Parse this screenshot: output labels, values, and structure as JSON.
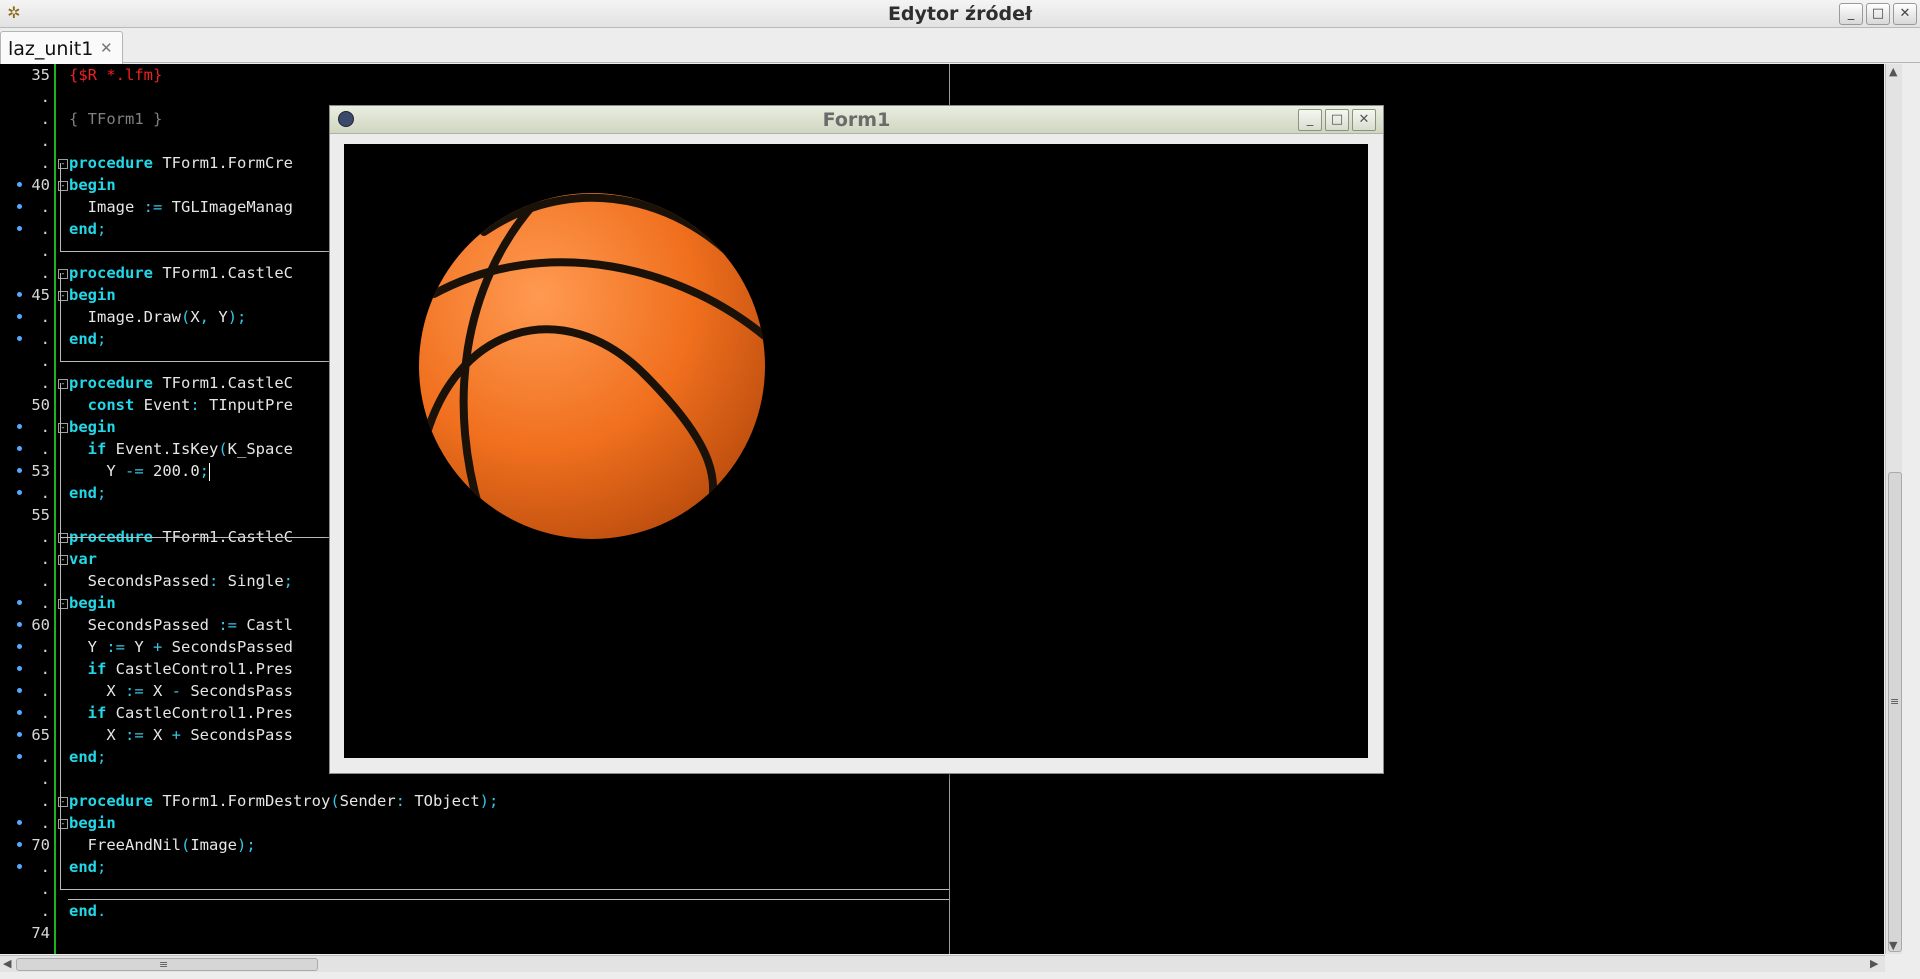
{
  "window": {
    "title": "Edytor źródeł",
    "min": "_",
    "max": "□",
    "close": "✕",
    "app_icon": "gear-star-icon"
  },
  "tab": {
    "label": "laz_unit1",
    "close": "✕"
  },
  "editor": {
    "rows": [
      {
        "ln": "35",
        "dot": false,
        "fold": false,
        "code": [
          [
            "dir",
            "{$R *.lfm}"
          ]
        ]
      },
      {
        "ln": ".",
        "dot": false,
        "fold": false,
        "code": []
      },
      {
        "ln": ".",
        "dot": false,
        "fold": false,
        "code": [
          [
            "cm",
            "{ TForm1 }"
          ]
        ]
      },
      {
        "ln": ".",
        "dot": false,
        "fold": false,
        "code": []
      },
      {
        "ln": ".",
        "dot": false,
        "fold": true,
        "code": [
          [
            "kw",
            "procedure"
          ],
          [
            "txt",
            " TForm1.FormCre"
          ]
        ]
      },
      {
        "ln": "40",
        "dot": true,
        "fold": true,
        "code": [
          [
            "kw",
            "begin"
          ]
        ]
      },
      {
        "ln": ".",
        "dot": true,
        "fold": false,
        "code": [
          [
            "txt",
            "  Image "
          ],
          [
            "sym",
            ":="
          ],
          [
            "txt",
            " TGLImageManag"
          ]
        ]
      },
      {
        "ln": ".",
        "dot": true,
        "fold": false,
        "code": [
          [
            "kw",
            "end"
          ],
          [
            "sym",
            ";"
          ]
        ]
      },
      {
        "ln": ".",
        "dot": false,
        "fold": false,
        "code": []
      },
      {
        "ln": ".",
        "dot": false,
        "fold": true,
        "code": [
          [
            "kw",
            "procedure"
          ],
          [
            "txt",
            " TForm1.CastleC"
          ]
        ]
      },
      {
        "ln": "45",
        "dot": true,
        "fold": true,
        "code": [
          [
            "kw",
            "begin"
          ]
        ]
      },
      {
        "ln": ".",
        "dot": true,
        "fold": false,
        "code": [
          [
            "txt",
            "  Image.Draw"
          ],
          [
            "sym",
            "("
          ],
          [
            "txt",
            "X"
          ],
          [
            "sym",
            ", "
          ],
          [
            "txt",
            "Y"
          ],
          [
            "sym",
            ");"
          ]
        ]
      },
      {
        "ln": ".",
        "dot": true,
        "fold": false,
        "code": [
          [
            "kw",
            "end"
          ],
          [
            "sym",
            ";"
          ]
        ]
      },
      {
        "ln": ".",
        "dot": false,
        "fold": false,
        "code": []
      },
      {
        "ln": ".",
        "dot": false,
        "fold": true,
        "code": [
          [
            "kw",
            "procedure"
          ],
          [
            "txt",
            " TForm1.CastleC"
          ]
        ]
      },
      {
        "ln": "50",
        "dot": false,
        "fold": false,
        "code": [
          [
            "kw",
            "  const"
          ],
          [
            "txt",
            " Event"
          ],
          [
            "sym",
            ":"
          ],
          [
            "txt",
            " TInputPre"
          ]
        ]
      },
      {
        "ln": ".",
        "dot": true,
        "fold": true,
        "code": [
          [
            "kw",
            "begin"
          ]
        ]
      },
      {
        "ln": ".",
        "dot": true,
        "fold": false,
        "code": [
          [
            "kw",
            "  if"
          ],
          [
            "txt",
            " Event.IsKey"
          ],
          [
            "sym",
            "("
          ],
          [
            "txt",
            "K_Space"
          ]
        ]
      },
      {
        "ln": "53",
        "dot": true,
        "fold": false,
        "caret": true,
        "code": [
          [
            "txt",
            "    Y "
          ],
          [
            "sym",
            "-="
          ],
          [
            "num",
            " 200.0"
          ],
          [
            "sym",
            ";"
          ]
        ]
      },
      {
        "ln": ".",
        "dot": true,
        "fold": false,
        "code": [
          [
            "kw",
            "end"
          ],
          [
            "sym",
            ";"
          ]
        ]
      },
      {
        "ln": "55",
        "dot": false,
        "fold": false,
        "code": []
      },
      {
        "ln": ".",
        "dot": false,
        "fold": true,
        "code": [
          [
            "kw",
            "procedure"
          ],
          [
            "txt",
            " TForm1.CastleC"
          ]
        ]
      },
      {
        "ln": ".",
        "dot": false,
        "fold": true,
        "code": [
          [
            "kw",
            "var"
          ]
        ]
      },
      {
        "ln": ".",
        "dot": false,
        "fold": false,
        "code": [
          [
            "txt",
            "  SecondsPassed"
          ],
          [
            "sym",
            ":"
          ],
          [
            "txt",
            " Single"
          ],
          [
            "sym",
            ";"
          ]
        ]
      },
      {
        "ln": ".",
        "dot": true,
        "fold": true,
        "code": [
          [
            "kw",
            "begin"
          ]
        ]
      },
      {
        "ln": "60",
        "dot": true,
        "fold": false,
        "code": [
          [
            "txt",
            "  SecondsPassed "
          ],
          [
            "sym",
            ":="
          ],
          [
            "txt",
            " Castl"
          ]
        ]
      },
      {
        "ln": ".",
        "dot": true,
        "fold": false,
        "code": [
          [
            "txt",
            "  Y "
          ],
          [
            "sym",
            ":="
          ],
          [
            "txt",
            " Y "
          ],
          [
            "sym",
            "+"
          ],
          [
            "txt",
            " SecondsPassed"
          ]
        ]
      },
      {
        "ln": ".",
        "dot": true,
        "fold": false,
        "code": [
          [
            "kw",
            "  if"
          ],
          [
            "txt",
            " CastleControl1.Pres"
          ]
        ]
      },
      {
        "ln": ".",
        "dot": true,
        "fold": false,
        "code": [
          [
            "txt",
            "    X "
          ],
          [
            "sym",
            ":="
          ],
          [
            "txt",
            " X "
          ],
          [
            "sym",
            "-"
          ],
          [
            "txt",
            " SecondsPass"
          ]
        ]
      },
      {
        "ln": ".",
        "dot": true,
        "fold": false,
        "code": [
          [
            "kw",
            "  if"
          ],
          [
            "txt",
            " CastleControl1.Pres"
          ]
        ]
      },
      {
        "ln": "65",
        "dot": true,
        "fold": false,
        "code": [
          [
            "txt",
            "    X "
          ],
          [
            "sym",
            ":="
          ],
          [
            "txt",
            " X "
          ],
          [
            "sym",
            "+"
          ],
          [
            "txt",
            " SecondsPass"
          ]
        ]
      },
      {
        "ln": ".",
        "dot": true,
        "fold": false,
        "code": [
          [
            "kw",
            "end"
          ],
          [
            "sym",
            ";"
          ]
        ]
      },
      {
        "ln": ".",
        "dot": false,
        "fold": false,
        "code": []
      },
      {
        "ln": ".",
        "dot": false,
        "fold": true,
        "code": [
          [
            "kw",
            "procedure"
          ],
          [
            "txt",
            " TForm1.FormDestroy"
          ],
          [
            "sym",
            "("
          ],
          [
            "txt",
            "Sender"
          ],
          [
            "sym",
            ":"
          ],
          [
            "txt",
            " TObject"
          ],
          [
            "sym",
            ");"
          ]
        ]
      },
      {
        "ln": ".",
        "dot": true,
        "fold": true,
        "code": [
          [
            "kw",
            "begin"
          ]
        ]
      },
      {
        "ln": "70",
        "dot": true,
        "fold": false,
        "code": [
          [
            "txt",
            "  FreeAndNil"
          ],
          [
            "sym",
            "("
          ],
          [
            "txt",
            "Image"
          ],
          [
            "sym",
            ");"
          ]
        ]
      },
      {
        "ln": ".",
        "dot": true,
        "fold": false,
        "code": [
          [
            "kw",
            "end"
          ],
          [
            "sym",
            ";"
          ]
        ]
      },
      {
        "ln": ".",
        "dot": false,
        "fold": false,
        "code": []
      },
      {
        "ln": ".",
        "dot": false,
        "fold": false,
        "code": [
          [
            "kw",
            "end"
          ],
          [
            "sym",
            "."
          ]
        ]
      },
      {
        "ln": "74",
        "dot": false,
        "fold": false,
        "code": []
      }
    ]
  },
  "form1": {
    "title": "Form1",
    "min": "_",
    "max": "□",
    "close": "✕",
    "icon": "lazarus-paw-icon",
    "image": "basketball-image"
  },
  "scrollbars": {
    "up": "▲",
    "down": "▼",
    "left": "◀",
    "right": "▶",
    "grip": "≡"
  }
}
